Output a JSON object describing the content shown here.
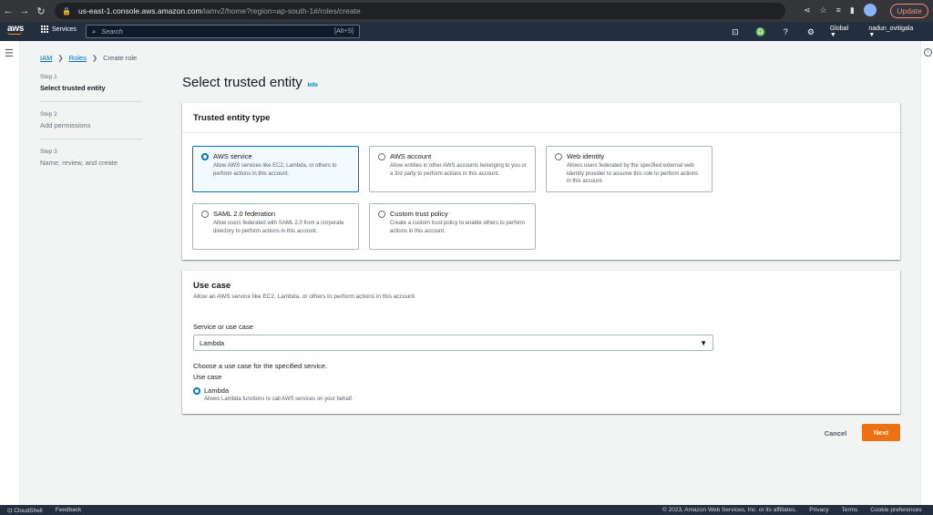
{
  "browser": {
    "url_host": "us-east-1.console.aws.amazon.com",
    "url_path": "/iamv2/home?region=ap-south-1#/roles/create",
    "update_label": "Update"
  },
  "aws_nav": {
    "logo": "aws",
    "services_label": "Services",
    "search_placeholder": "Search",
    "search_shortcut": "[Alt+S]",
    "region": "Global ▼",
    "user": "nadun_ovitigala ▼"
  },
  "breadcrumb": {
    "items": [
      "IAM",
      "Roles",
      "Create role"
    ]
  },
  "steps": [
    {
      "num": "Step 1",
      "label": "Select trusted entity"
    },
    {
      "num": "Step 2",
      "label": "Add permissions"
    },
    {
      "num": "Step 3",
      "label": "Name, review, and create"
    }
  ],
  "page": {
    "title": "Select trusted entity",
    "info": "Info"
  },
  "trusted_entity": {
    "heading": "Trusted entity type",
    "options": [
      {
        "title": "AWS service",
        "desc": "Allow AWS services like EC2, Lambda, or others to perform actions in this account.",
        "selected": true
      },
      {
        "title": "AWS account",
        "desc": "Allow entities in other AWS accounts belonging to you or a 3rd party to perform actions in this account.",
        "selected": false
      },
      {
        "title": "Web identity",
        "desc": "Allows users federated by the specified external web identity provider to assume this role to perform actions in this account.",
        "selected": false
      },
      {
        "title": "SAML 2.0 federation",
        "desc": "Allow users federated with SAML 2.0 from a corporate directory to perform actions in this account.",
        "selected": false
      },
      {
        "title": "Custom trust policy",
        "desc": "Create a custom trust policy to enable others to perform actions in this account.",
        "selected": false
      }
    ]
  },
  "use_case": {
    "heading": "Use case",
    "desc": "Allow an AWS service like EC2, Lambda, or others to perform actions in this account.",
    "service_label": "Service or use case",
    "service_value": "Lambda",
    "choose_label": "Choose a use case for the specified service.",
    "use_case_label": "Use case",
    "option_title": "Lambda",
    "option_desc": "Allows Lambda functions to call AWS services on your behalf."
  },
  "actions": {
    "cancel": "Cancel",
    "next": "Next"
  },
  "footer": {
    "cloudshell": "CloudShell",
    "feedback": "Feedback",
    "copyright": "© 2023, Amazon Web Services, Inc. or its affiliates.",
    "privacy": "Privacy",
    "terms": "Terms",
    "cookies": "Cookie preferences"
  },
  "colors": {
    "accent": "#0073bb",
    "primary_button": "#ec7211",
    "nav_bg": "#232f3e"
  }
}
